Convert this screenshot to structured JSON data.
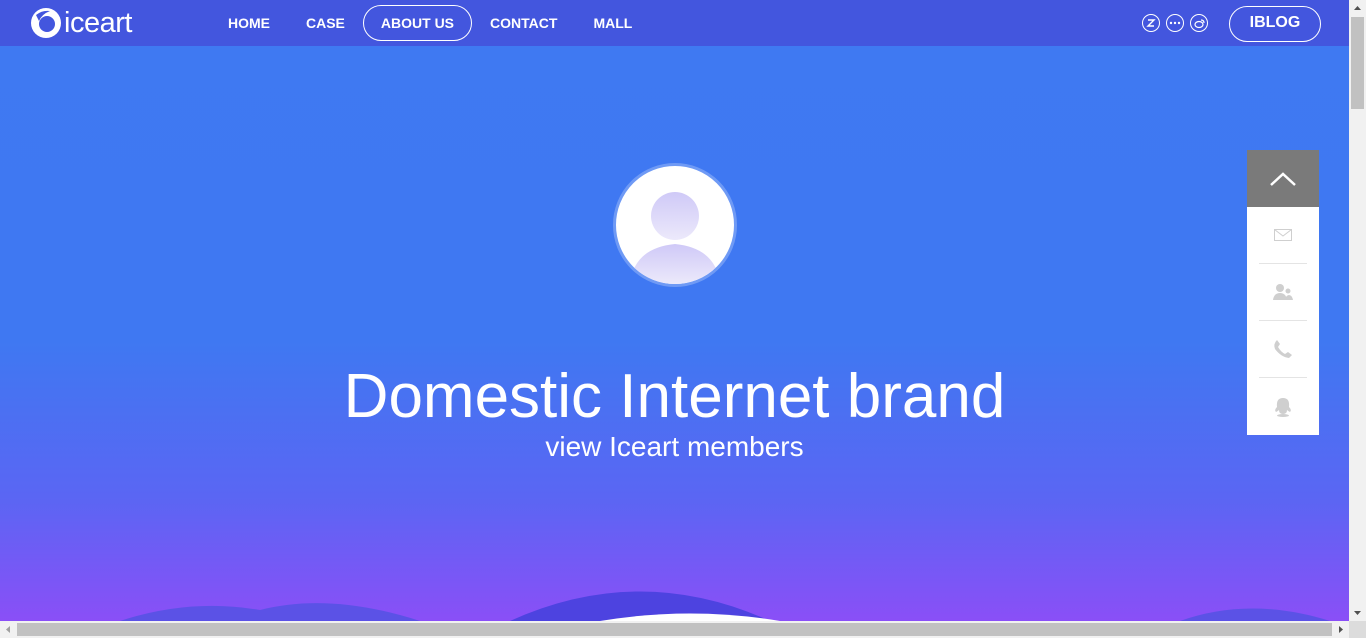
{
  "header": {
    "logo_text": "iceart",
    "nav": [
      {
        "label": "HOME",
        "active": false
      },
      {
        "label": "CASE",
        "active": false
      },
      {
        "label": "ABOUT US",
        "active": true
      },
      {
        "label": "CONTACT",
        "active": false
      },
      {
        "label": "MALL",
        "active": false
      }
    ],
    "social_icons": [
      "zhihu-icon",
      "more-dots-icon",
      "weibo-icon"
    ],
    "blog_label": "IBLOG"
  },
  "hero": {
    "title": "Domestic Internet brand",
    "subtitle": "view Iceart members"
  },
  "sidebar": {
    "items": [
      "mail-icon",
      "contacts-icon",
      "phone-icon",
      "qq-icon"
    ]
  },
  "colors": {
    "header_bg": "#4356de",
    "hero_top": "#3f79f2",
    "hero_bottom": "#8a4ff7",
    "to_top_bg": "#7a7a7a"
  }
}
